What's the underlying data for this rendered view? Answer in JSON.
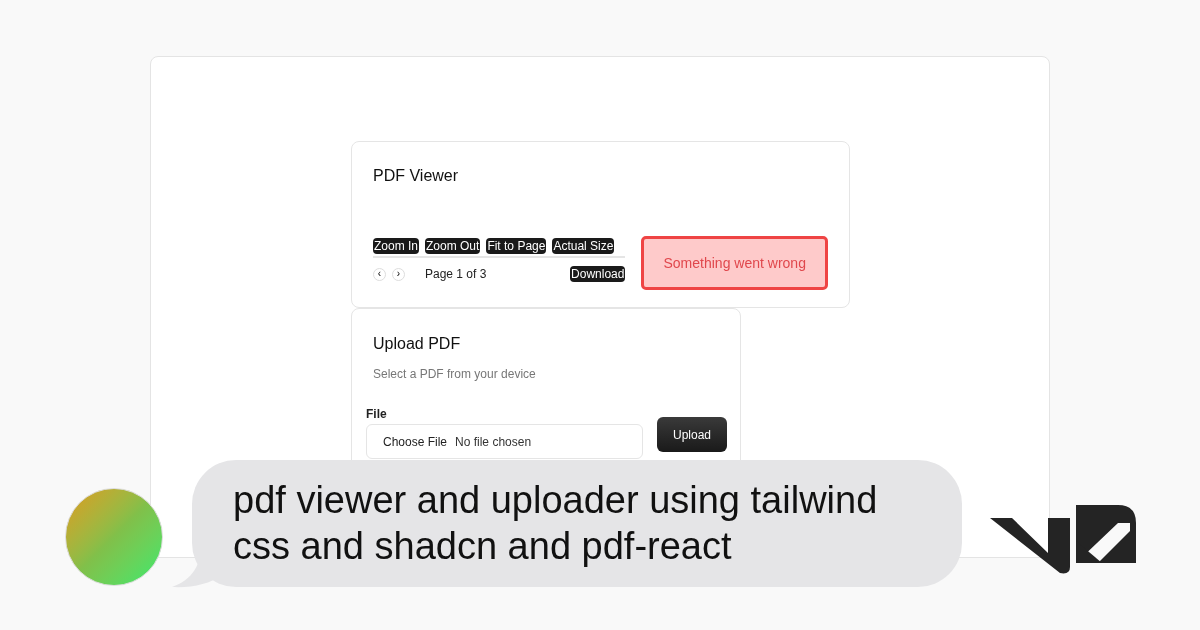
{
  "viewer": {
    "title": "PDF Viewer",
    "toolbar": [
      "Zoom In",
      "Zoom Out",
      "Fit to Page",
      "Actual Size"
    ],
    "prev_label": "‹",
    "next_label": "›",
    "page_info": "Page 1 of 3",
    "download": "Download",
    "error": "Something went wrong"
  },
  "upload": {
    "title": "Upload PDF",
    "description": "Select a PDF from your device",
    "field_label": "File",
    "choose_button": "Choose File",
    "file_status": "No file chosen",
    "submit": "Upload"
  },
  "message": {
    "text": "pdf viewer and uploader using tailwindcss and shadcn and pdf-react"
  }
}
